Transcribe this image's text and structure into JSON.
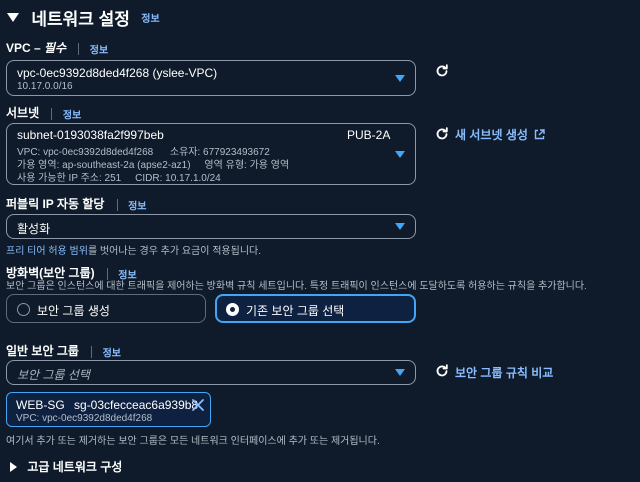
{
  "header": {
    "title": "네트워크 설정",
    "info": "정보"
  },
  "vpc": {
    "label": "VPC – ",
    "required": "필수",
    "info": "정보",
    "value": "vpc-0ec9392d8ded4f268 (yslee-VPC)",
    "cidr": "10.17.0.0/16"
  },
  "subnet": {
    "label": "서브넷",
    "info": "정보",
    "id": "subnet-0193038fa2f997beb",
    "name": "PUB-2A",
    "line2": "VPC: vpc-0ec9392d8ded4f268      소유자: 677923493672",
    "line3": "가용 영역: ap-southeast-2a (apse2-az1)     영역 유형: 가용 영역",
    "line4": "사용 가능한 IP 주소: 251     CIDR: 10.17.1.0/24",
    "new_link": "새 서브넷 생성"
  },
  "public_ip": {
    "label": "퍼블릭 IP 자동 할당",
    "info": "정보",
    "value": "활성화",
    "hint_link": "프리 티어 허용 범위",
    "hint_rest": "를 벗어나는 경우 추가 요금이 적용됩니다."
  },
  "firewall": {
    "label": "방화벽(보안 그룹)",
    "info": "정보",
    "description": "보안 그룹은 인스턴스에 대한 트래픽을 제어하는 방화벽 규칙 세트입니다. 특정 트래픽이 인스턴스에 도달하도록 허용하는 규칙을 추가합니다.",
    "option_create": "보안 그룹 생성",
    "option_existing": "기존 보안 그룹 선택"
  },
  "common_sg": {
    "label": "일반 보안 그룹",
    "info": "정보",
    "placeholder": "보안 그룹 선택",
    "compare_link": "보안 그룹 규칙 비교",
    "token_name": "WEB-SG",
    "token_id": "sg-03cfecceac6a939b8",
    "token_vpc": "VPC: vpc-0ec9392d8ded4f268",
    "hint": "여기서 추가 또는 제거하는 보안 그룹은 모든 네트워크 인터페이스에 추가 또는 제거됩니다."
  },
  "advanced": {
    "label": "고급 네트워크 구성"
  },
  "colors": {
    "accent": "#42a5f5",
    "link": "#89bdff",
    "background": "#0f1b2a",
    "border": "#8d99a8"
  }
}
